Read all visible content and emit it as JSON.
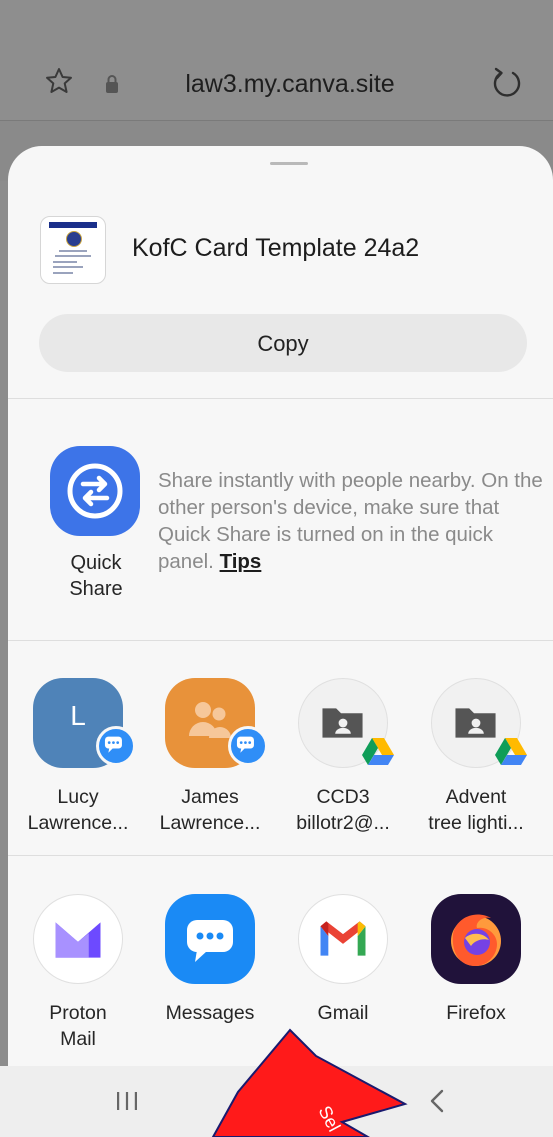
{
  "browser": {
    "url": "law3.my.canva.site"
  },
  "share_sheet": {
    "document_title": "KofC Card Template 24a2",
    "copy_label": "Copy",
    "quick_share": {
      "label_line1": "Quick",
      "label_line2": "Share",
      "description": "Share instantly with people nearby. On the other person's device, make sure that Quick Share is turned on in the quick panel.",
      "tips_link": "Tips"
    },
    "direct_share": [
      {
        "line1": "Lucy",
        "line2": "Lawrence...",
        "avatar_letter": "L",
        "icon": "messages-badge-icon"
      },
      {
        "line1": "James",
        "line2": "Lawrence...",
        "icon": "group-avatar-icon"
      },
      {
        "line1": "CCD3",
        "line2": "billotr2@...",
        "icon": "shared-drive-folder-icon"
      },
      {
        "line1": "Advent",
        "line2": "tree lighti...",
        "icon": "shared-drive-folder-icon"
      }
    ],
    "apps": [
      {
        "line1": "Proton",
        "line2": "Mail",
        "icon": "proton-mail-icon"
      },
      {
        "line1": "Messages",
        "line2": "",
        "icon": "messages-icon"
      },
      {
        "line1": "Gmail",
        "line2": "",
        "icon": "gmail-icon"
      },
      {
        "line1": "Firefox",
        "line2": "",
        "icon": "firefox-icon"
      }
    ]
  },
  "annotation": {
    "arrow_text": "Sel",
    "arrow_color": "#ff1a1a"
  },
  "colors": {
    "quick_share_blue": "#3d74e8",
    "badge_blue": "#2f8ef7",
    "sheet_bg": "#f7f7f7"
  }
}
